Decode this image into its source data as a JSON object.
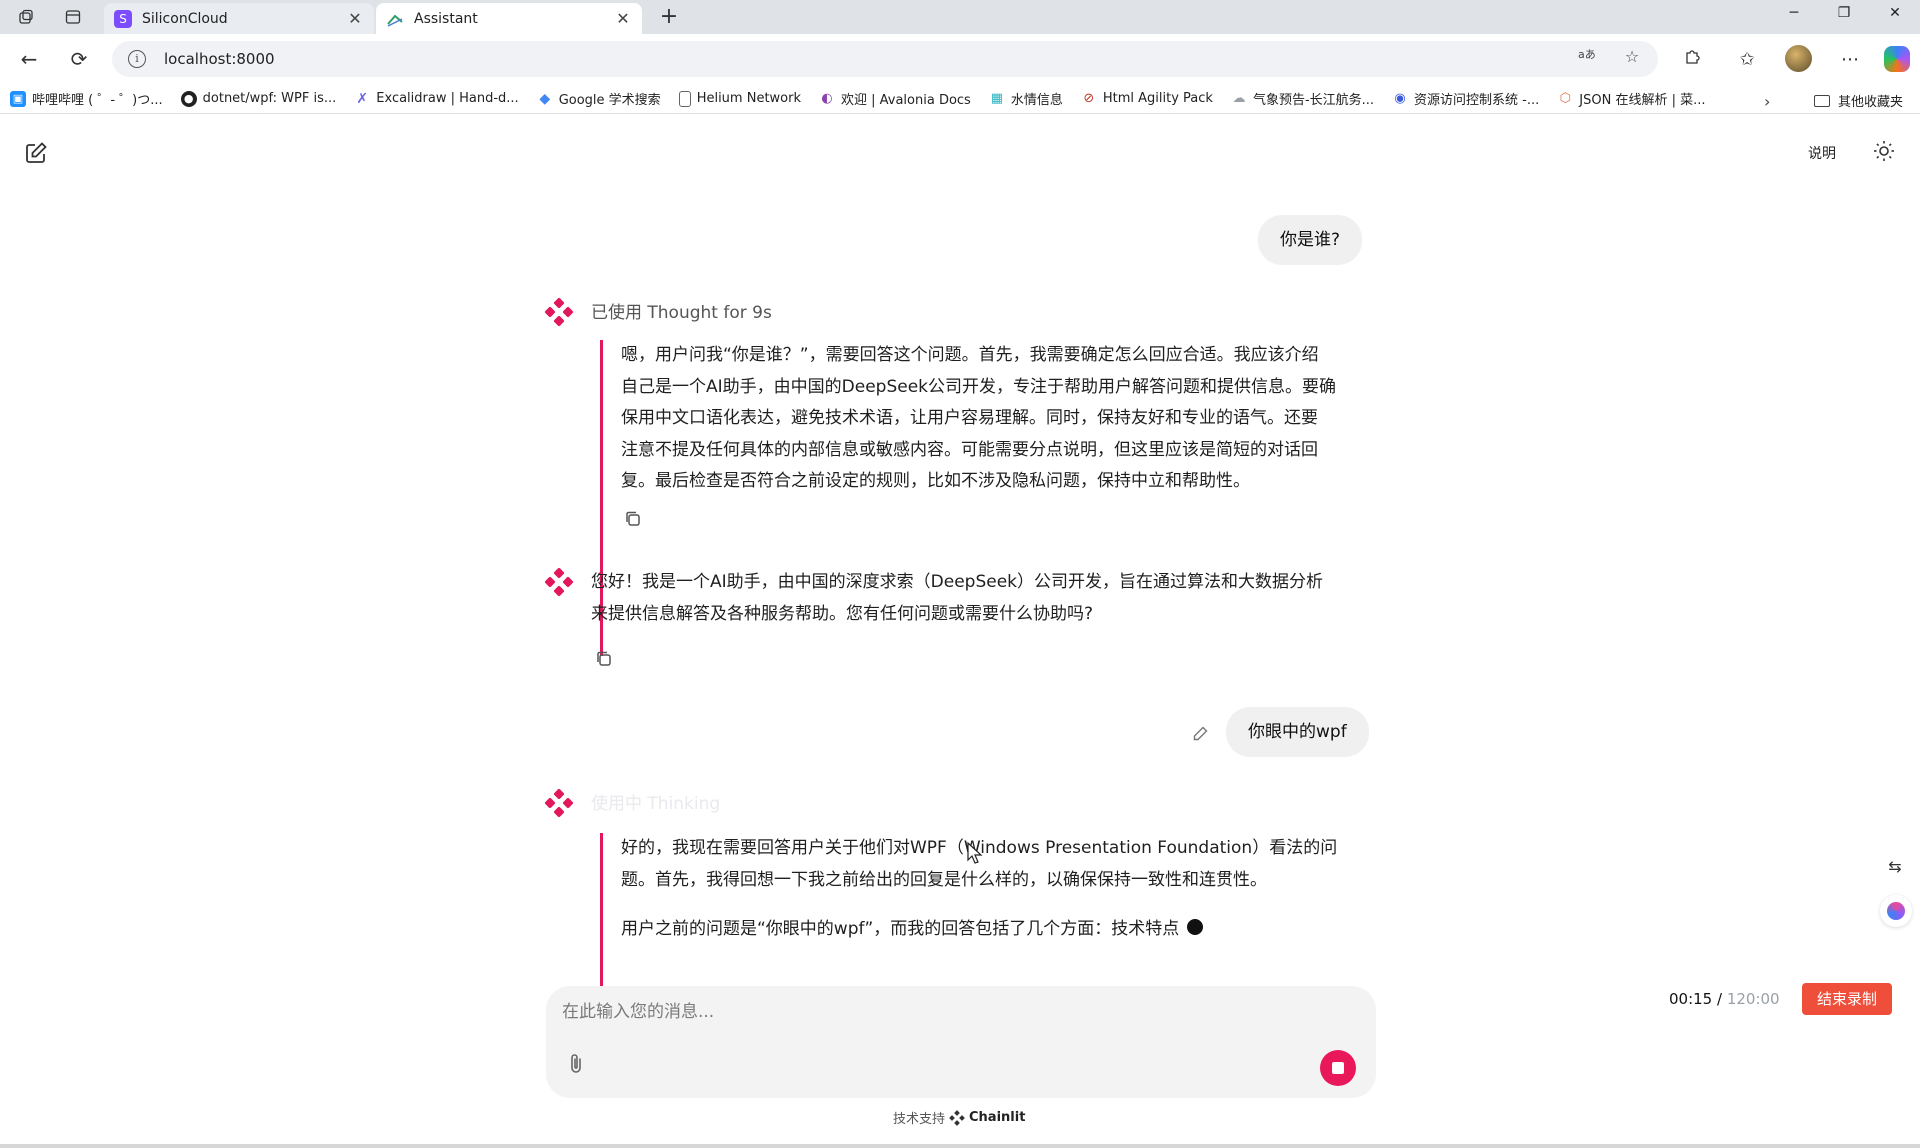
{
  "browser": {
    "tabs": [
      {
        "title": "SiliconCloud",
        "active": false,
        "icon": "siliconcloud-icon"
      },
      {
        "title": "Assistant",
        "active": true,
        "icon": "chainlit-icon"
      }
    ],
    "url": "localhost:8000",
    "bookmarks": [
      {
        "label": "哔哩哔哩 ( ゜- ゜)つ...",
        "icon": "bilibili-icon",
        "color": "#1e90ff"
      },
      {
        "label": "dotnet/wpf: WPF is...",
        "icon": "github-icon",
        "color": "#222222"
      },
      {
        "label": "Excalidraw | Hand-d...",
        "icon": "excalidraw-icon",
        "color": "#6965db"
      },
      {
        "label": "Google 学术搜索",
        "icon": "google-scholar-icon",
        "color": "#4285f4"
      },
      {
        "label": "Helium Network",
        "icon": "document-icon",
        "color": "#666666"
      },
      {
        "label": "欢迎 | Avalonia Docs",
        "icon": "avalonia-icon",
        "color": "#8b44ac"
      },
      {
        "label": "水情信息",
        "icon": "water-icon",
        "color": "#2bb3c0"
      },
      {
        "label": "Html Agility Pack",
        "icon": "htmlagility-icon",
        "color": "#c0392b"
      },
      {
        "label": "气象预告-长江航务...",
        "icon": "weather-icon",
        "color": "#9aa0a6"
      },
      {
        "label": "资源访问控制系统 -...",
        "icon": "access-control-icon",
        "color": "#3b5bdb"
      },
      {
        "label": "JSON 在线解析 | 菜...",
        "icon": "json-icon",
        "color": "#e8734a"
      }
    ],
    "other_bookmarks": "其他收藏夹"
  },
  "app": {
    "header": {
      "help": "说明"
    },
    "messages": [
      {
        "role": "user",
        "text": "你是谁?"
      },
      {
        "role": "step",
        "label": "已使用 Thought for 9s",
        "thought_lines": [
          "嗯，用户问我“你是谁？”，需要回答这个问题。首先，我需要确定怎么回应合适。我应该介绍",
          "自己是一个AI助手，由中国的DeepSeek公司开发，专注于帮助用户解答问题和提供信息。要确",
          "保用中文口语化表达，避免技术术语，让用户容易理解。同时，保持友好和专业的语气。还要",
          "注意不提及任何具体的内部信息或敏感内容。可能需要分点说明，但这里应该是简短的对话回",
          "复。最后检查是否符合之前设定的规则，比如不涉及隐私问题，保持中立和帮助性。"
        ]
      },
      {
        "role": "assistant",
        "lines": [
          "您好！我是一个AI助手，由中国的深度求索（DeepSeek）公司开发，旨在通过算法和大数据分析",
          "来提供信息解答及各种服务帮助。您有任何问题或需要什么协助吗?"
        ]
      },
      {
        "role": "user",
        "text": "你眼中的wpf"
      },
      {
        "role": "step",
        "label": "使用中 Thinking",
        "thought_lines": [
          "好的，我现在需要回答用户关于他们对WPF（Windows Presentation Foundation）看法的问",
          "题。首先，我得回想一下我之前给出的回复是什么样的，以确保保持一致性和连贯性。"
        ],
        "thought_tail": "用户之前的问题是“你眼中的wpf”，而我的回答包括了几个方面：技术特点"
      }
    ],
    "composer": {
      "placeholder": "在此输入您的消息..."
    },
    "footer": {
      "powered_prefix": "技术支持",
      "powered_brand": "Chainlit"
    },
    "recording": {
      "elapsed": "00:15",
      "separator": " / ",
      "total": "120:00",
      "stop_label": "结束录制"
    },
    "accent_color": "#e2185b"
  }
}
